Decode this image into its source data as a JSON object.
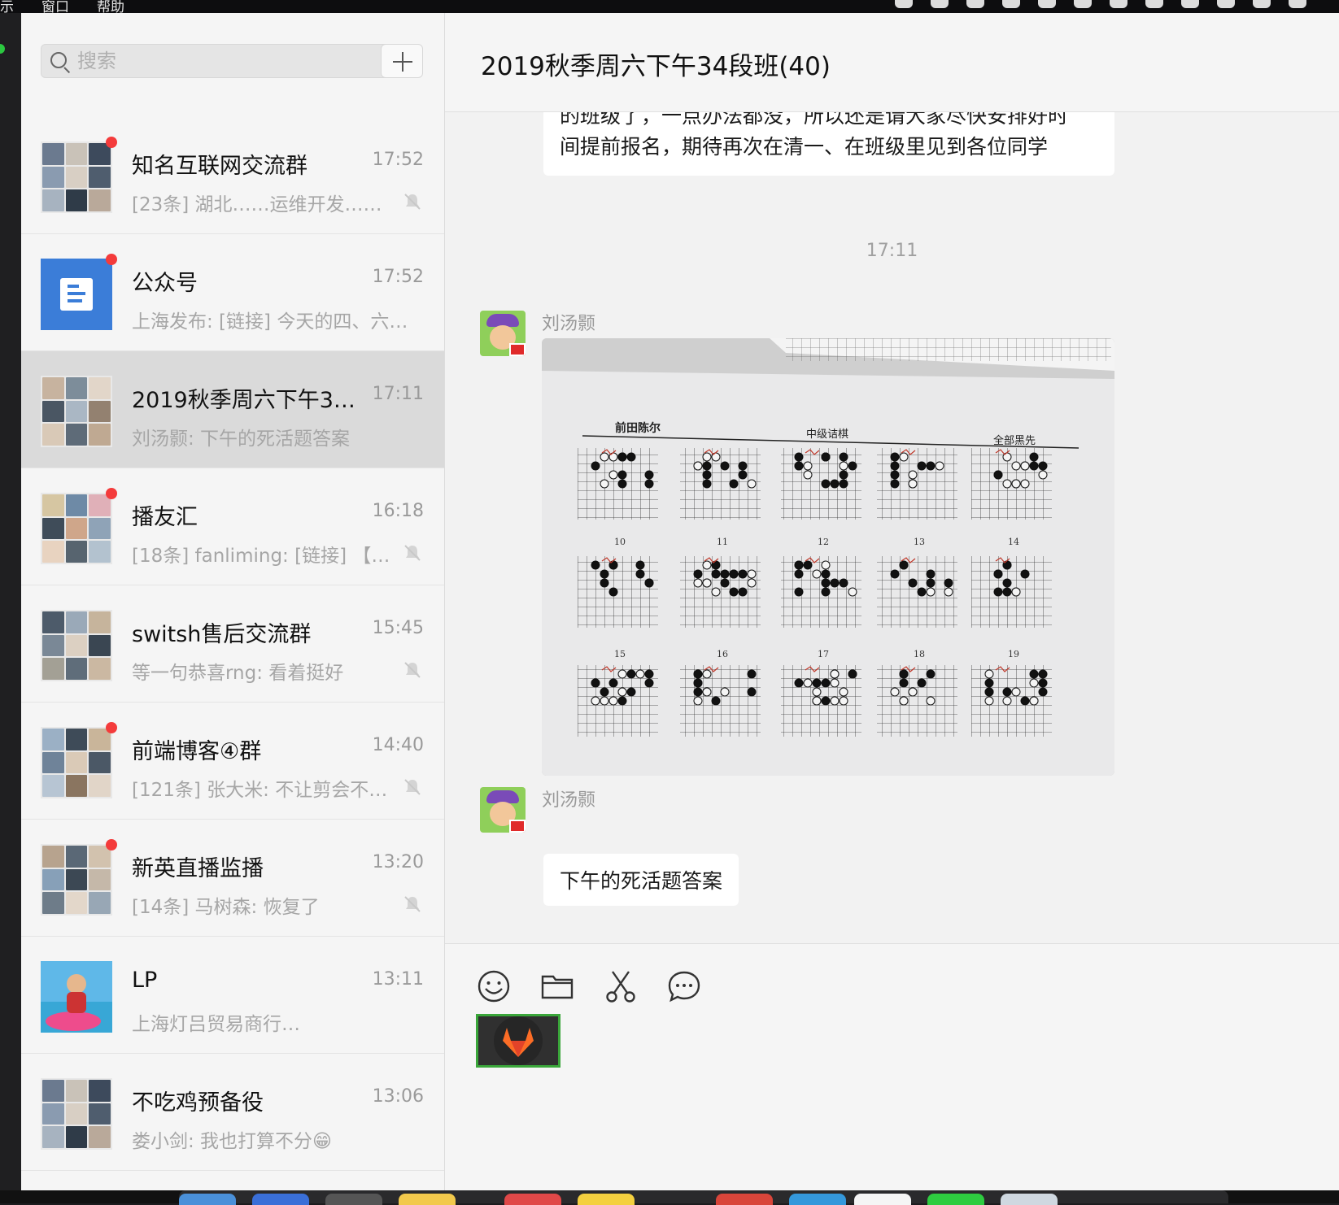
{
  "menubar": {
    "items": [
      "示",
      "窗口",
      "帮助"
    ]
  },
  "sidebar": {
    "search_placeholder": "搜索",
    "chats": [
      {
        "name": "知名互联网交流群",
        "time": "17:52",
        "preview": "[23条] 湖北……运维开发……",
        "unread": true,
        "muted": true,
        "avatar": "grid"
      },
      {
        "name": "公众号",
        "time": "17:52",
        "preview": "上海发布: [链接] 今天的四、六…",
        "unread": true,
        "muted": false,
        "avatar": "official"
      },
      {
        "name": "2019秋季周六下午3…",
        "time": "17:11",
        "preview": "刘汤颢: 下午的死活题答案",
        "unread": false,
        "muted": false,
        "avatar": "grid",
        "selected": true
      },
      {
        "name": "播友汇",
        "time": "16:18",
        "preview": "[18条] fanliming: [链接] 【…",
        "unread": true,
        "muted": true,
        "avatar": "grid"
      },
      {
        "name": "switsh售后交流群",
        "time": "15:45",
        "preview": "等一句恭喜rng: 看着挺好",
        "unread": false,
        "muted": true,
        "avatar": "grid"
      },
      {
        "name": "前端博客④群",
        "time": "14:40",
        "preview": "[121条] 张大米: 不让剪会不…",
        "unread": true,
        "muted": true,
        "avatar": "grid"
      },
      {
        "name": "新英直播监播",
        "time": "13:20",
        "preview": "[14条] 马树森: 恢复了",
        "unread": true,
        "muted": true,
        "avatar": "grid"
      },
      {
        "name": "LP",
        "time": "13:11",
        "preview": "上海灯吕贸易商行…",
        "unread": false,
        "muted": false,
        "avatar": "photo"
      },
      {
        "name": "不吃鸡预备役",
        "time": "13:06",
        "preview": "娄小剑: 我也打算不分😁",
        "unread": false,
        "muted": false,
        "avatar": "grid"
      }
    ]
  },
  "chat": {
    "title": "2019秋季周六下午34段班(40)",
    "top_message_line1": "的班级了，一点办法都没，所以还是请大家尽快安排好时",
    "top_message_line2": "间提前报名，期待再次在清一、在班级里见到各位同学",
    "timestamp": "17:11",
    "sender1": "刘汤颢",
    "image_text": {
      "section1": "前田陈尔",
      "section2": "中级诘棋",
      "section3": "全部黑先",
      "row2_labels": [
        "10",
        "11",
        "12",
        "13",
        "14"
      ],
      "row3_labels": [
        "15",
        "16",
        "17",
        "18",
        "19"
      ]
    },
    "sender2": "刘汤颢",
    "bottom_message": "下午的死活题答案"
  },
  "composer": {
    "tools": [
      "emoji-icon",
      "folder-icon",
      "scissors-icon",
      "chat-bubble-icon"
    ]
  },
  "colors": {
    "accent_unread": "#f43b3b",
    "selected_row": "#dadada",
    "official_blue": "#3b7dd8",
    "sidebar_bg": "#f5f5f5"
  }
}
